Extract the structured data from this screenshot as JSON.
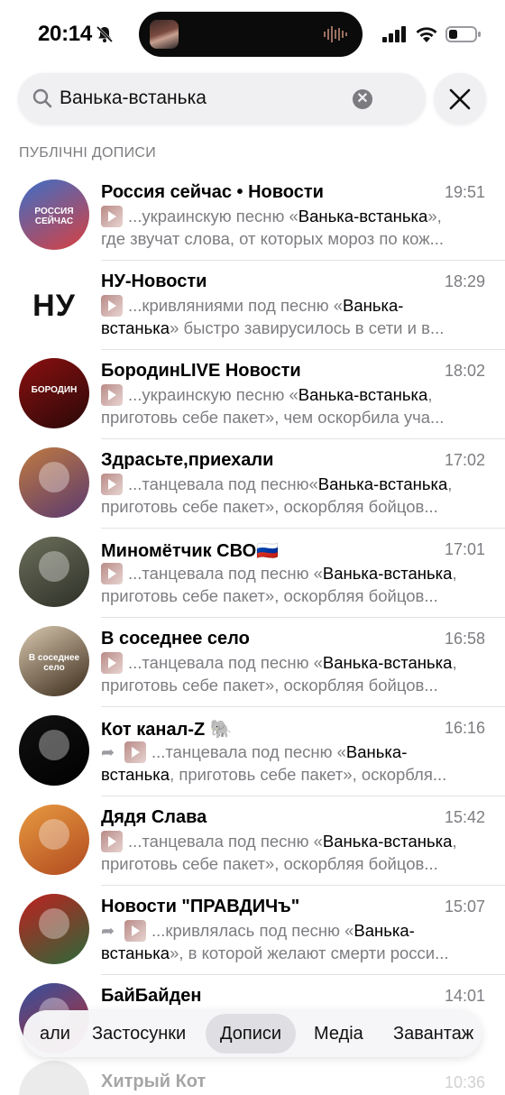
{
  "status": {
    "time": "20:14"
  },
  "search": {
    "value": "Ванька-встанька",
    "clear_symbol": "✕"
  },
  "section_title": "ПУБЛІЧНІ ДОПИСИ",
  "rows": [
    {
      "name": "Россия сейчас • Новости",
      "time": "19:51",
      "forwarded": false,
      "l1_pre": "...украинскую песню «",
      "l1_hl": "Ванька-встанька",
      "l1_post": "»,",
      "l2_hl": "",
      "l2": "где звучат слова, от которых мороз по кож...",
      "avatar": {
        "text": "РОССИЯ СЕЙЧАС",
        "bg1": "#3b6fc8",
        "bg2": "#d94040"
      }
    },
    {
      "name": "НУ-Новости",
      "time": "18:29",
      "forwarded": false,
      "l1_pre": "...кривляниями под песню «",
      "l1_hl": "Ванька-",
      "l1_post": "",
      "l2_hl": "встанька",
      "l2": "» быстро завирусилось в сети и в...",
      "avatar": {
        "text": "НУ",
        "bg1": "#ffffff",
        "bg2": "#ffffff"
      }
    },
    {
      "name": "БородинLIVE Новости",
      "time": "18:02",
      "forwarded": false,
      "l1_pre": "...украинскую песню «",
      "l1_hl": "Ванька-встанька",
      "l1_post": ",",
      "l2_hl": "",
      "l2": "приготовь себе пакет», чем оскорбила уча...",
      "avatar": {
        "text": "БОРОДИН",
        "bg1": "#8b1010",
        "bg2": "#2a0808"
      }
    },
    {
      "name": "Здрасьте,приехали",
      "time": "17:02",
      "forwarded": false,
      "l1_pre": "...танцевала под песню«",
      "l1_hl": "Ванька-встанька",
      "l1_post": ",",
      "l2_hl": "",
      "l2": "приготовь себе пакет», оскорбляя бойцов...",
      "avatar": {
        "text": "",
        "bg1": "#c07a40",
        "bg2": "#5a3a70"
      }
    },
    {
      "name": "Миномётчик СВО🇷🇺",
      "time": "17:01",
      "forwarded": false,
      "l1_pre": "...танцевала под песню «",
      "l1_hl": "Ванька-встанька",
      "l1_post": ",",
      "l2_hl": "",
      "l2": "приготовь себе пакет», оскорбляя бойцов...",
      "avatar": {
        "text": "",
        "bg1": "#6b6f5a",
        "bg2": "#2e3028"
      }
    },
    {
      "name": "В соседнее село",
      "time": "16:58",
      "forwarded": false,
      "l1_pre": "...танцевала под песню «",
      "l1_hl": "Ванька-встанька",
      "l1_post": ",",
      "l2_hl": "",
      "l2": "приготовь себе пакет», оскорбляя бойцов...",
      "avatar": {
        "text": "В соседнее село",
        "bg1": "#d9c9b0",
        "bg2": "#3a2a1a"
      }
    },
    {
      "name": "Кот канал-Z 🐘",
      "time": "16:16",
      "forwarded": true,
      "l1_pre": "...танцевала под песню «",
      "l1_hl": "Ванька-",
      "l1_post": "",
      "l2_hl": "встанька",
      "l2": ", приготовь себе пакет», оскорбля...",
      "avatar": {
        "text": "",
        "bg1": "#111111",
        "bg2": "#000000"
      }
    },
    {
      "name": "Дядя Слава",
      "time": "15:42",
      "forwarded": false,
      "l1_pre": "...танцевала под песню «",
      "l1_hl": "Ванька-встанька",
      "l1_post": ",",
      "l2_hl": "",
      "l2": "приготовь себе пакет», оскорбляя бойцов...",
      "avatar": {
        "text": "",
        "bg1": "#e89a40",
        "bg2": "#b04a20"
      }
    },
    {
      "name": "Новости \"ПРАВДИЧъ\"",
      "time": "15:07",
      "forwarded": true,
      "l1_pre": "...кривлялась под песню «",
      "l1_hl": "Ванька-",
      "l1_post": "",
      "l2_hl": "встанька",
      "l2": "», в которой желают смерти росси...",
      "avatar": {
        "text": "",
        "bg1": "#c02020",
        "bg2": "#2a6a3a"
      }
    },
    {
      "name": "БайБайден",
      "time": "14:01",
      "forwarded": false,
      "l1_pre": "",
      "l1_hl": "",
      "l1_post": "",
      "l2_hl": "",
      "l2": "",
      "avatar": {
        "text": "",
        "bg1": "#3050a0",
        "bg2": "#c03030"
      }
    }
  ],
  "faded_row": {
    "name": "Хитрый Кот",
    "time": "10:36"
  },
  "tabs": [
    {
      "label": "али",
      "active": false
    },
    {
      "label": "Застосунки",
      "active": false
    },
    {
      "label": "Дописи",
      "active": true
    },
    {
      "label": "Медіа",
      "active": false
    },
    {
      "label": "Завантаж",
      "active": false
    }
  ],
  "colors": {
    "secondary_text": "#7d7d82",
    "divider": "#e2e2e6",
    "tab_active_bg": "#dfdfe3"
  },
  "icons": [
    "bell-slash-icon",
    "signal-icon",
    "wifi-icon",
    "battery-icon",
    "search-icon",
    "clear-icon",
    "close-icon",
    "play-thumbnail-icon",
    "forward-icon"
  ]
}
